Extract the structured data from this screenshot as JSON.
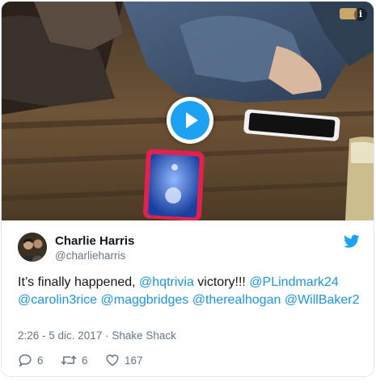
{
  "tweet": {
    "author_name": "Charlie Harris",
    "author_handle": "@charlieharris",
    "text_parts": [
      {
        "type": "text",
        "value": "It’s finally happened, "
      },
      {
        "type": "link",
        "value": "@hqtrivia"
      },
      {
        "type": "text",
        "value": " victory!!! "
      },
      {
        "type": "link",
        "value": "@PLindmark24"
      },
      {
        "type": "text",
        "value": " "
      },
      {
        "type": "link",
        "value": "@carolin3rice"
      },
      {
        "type": "text",
        "value": " "
      },
      {
        "type": "link",
        "value": "@maggbridges"
      },
      {
        "type": "text",
        "value": " "
      },
      {
        "type": "link",
        "value": "@therealhogan"
      },
      {
        "type": "text",
        "value": " "
      },
      {
        "type": "link",
        "value": "@WillBaker2"
      }
    ],
    "time": "2:26 - 5 dic. 2017",
    "separator": "·",
    "place": "Shake Shack",
    "reply_count": "6",
    "retweet_count": "6",
    "like_count": "167"
  },
  "icons": {
    "info": "info-icon",
    "play": "play-icon",
    "brand": "twitter-bird-icon",
    "reply": "reply-icon",
    "retweet": "retweet-icon",
    "like": "heart-icon"
  },
  "colors": {
    "accent": "#1da1f2",
    "link": "#1b95e0",
    "secondary_text": "#657786",
    "border": "#e1e8ed"
  }
}
